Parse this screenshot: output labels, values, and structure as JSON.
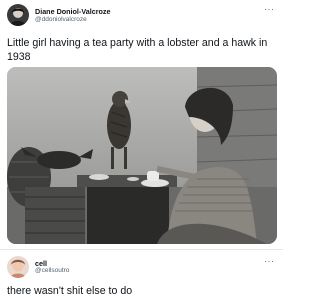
{
  "tweet": {
    "author_name": "Diane Doniol-Valcroze",
    "author_handle": "@ddoniolvalcroze",
    "more_icon": "more-horizontal-icon",
    "text": "Little girl having a tea party with a lobster and a hawk in 1938",
    "photo_icon": "photograph"
  },
  "reply": {
    "author_name": "cell",
    "author_handle": "@cellsoutro",
    "more_icon": "more-horizontal-icon",
    "text": "there wasn't shit else to do"
  }
}
